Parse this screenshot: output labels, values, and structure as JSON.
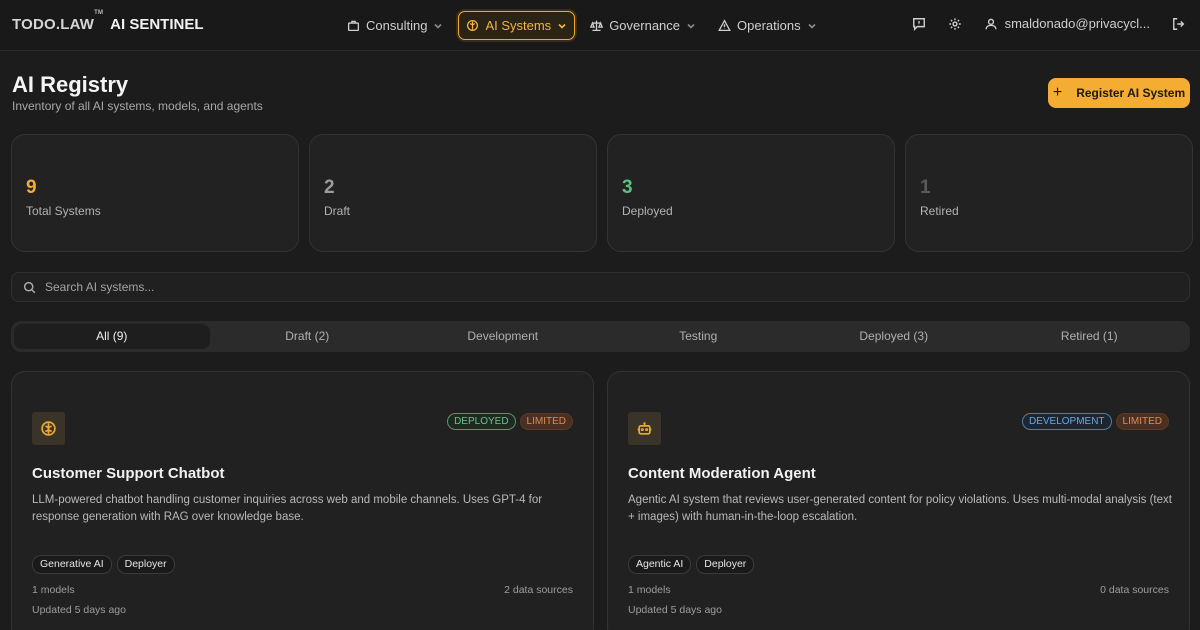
{
  "brand": {
    "name": "TODO.LAW",
    "trademark": "TM",
    "product": "AI SENTINEL"
  },
  "nav": {
    "items": [
      {
        "label": "Consulting",
        "icon": "briefcase-icon",
        "active": false
      },
      {
        "label": "AI Systems",
        "icon": "brain-icon",
        "active": true
      },
      {
        "label": "Governance",
        "icon": "scale-icon",
        "active": false
      },
      {
        "label": "Operations",
        "icon": "warning-icon",
        "active": false
      }
    ],
    "user_email": "smaldonado@privacycl...",
    "right_icons": [
      "feedback-icon",
      "settings-icon",
      "user-icon",
      "logout-icon"
    ]
  },
  "header": {
    "title": "AI Registry",
    "subtitle": "Inventory of all AI systems, models, and agents",
    "register_label": "Register AI System"
  },
  "stats": [
    {
      "value": "9",
      "label": "Total Systems",
      "color": "#f4ac32"
    },
    {
      "value": "2",
      "label": "Draft",
      "color": "#9c9c9c"
    },
    {
      "value": "3",
      "label": "Deployed",
      "color": "#5fbf7f"
    },
    {
      "value": "1",
      "label": "Retired",
      "color": "#5a5a5a"
    }
  ],
  "search": {
    "placeholder": "Search AI systems..."
  },
  "tabs": [
    {
      "label": "All (9)",
      "active": true
    },
    {
      "label": "Draft (2)",
      "active": false
    },
    {
      "label": "Development",
      "active": false
    },
    {
      "label": "Testing",
      "active": false
    },
    {
      "label": "Deployed (3)",
      "active": false
    },
    {
      "label": "Retired (1)",
      "active": false
    }
  ],
  "systems": [
    {
      "icon": "brain-icon",
      "status": "DEPLOYED",
      "risk": "LIMITED",
      "title": "Customer Support Chatbot",
      "description": "LLM-powered chatbot handling customer inquiries across web and mobile channels. Uses GPT-4 for response generation with RAG over knowledge base.",
      "tags": [
        "Generative AI",
        "Deployer"
      ],
      "models": "1 models",
      "data_sources": "2 data sources",
      "updated": "Updated 5 days ago"
    },
    {
      "icon": "bot-icon",
      "status": "DEVELOPMENT",
      "risk": "LIMITED",
      "title": "Content Moderation Agent",
      "description": "Agentic AI system that reviews user-generated content for policy violations. Uses multi-modal analysis (text + images) with human-in-the-loop escalation.",
      "tags": [
        "Agentic AI",
        "Deployer"
      ],
      "models": "1 models",
      "data_sources": "0 data sources",
      "updated": "Updated 5 days ago"
    }
  ],
  "colors": {
    "accent": "#f4ac32",
    "background": "#1c1c1c"
  }
}
